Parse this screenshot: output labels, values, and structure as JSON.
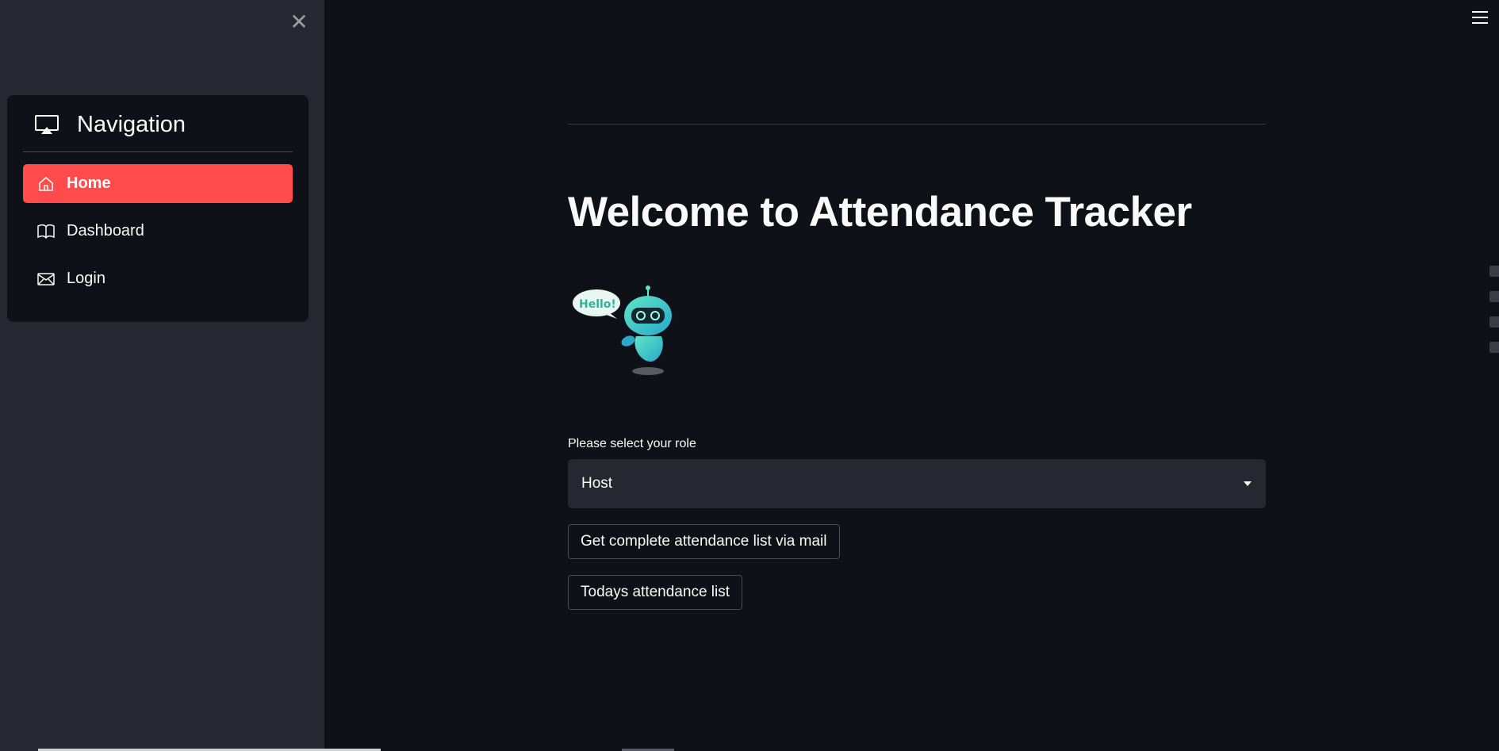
{
  "sidebar": {
    "title": "Navigation",
    "items": [
      {
        "label": "Home",
        "icon": "house-icon",
        "active": true
      },
      {
        "label": "Dashboard",
        "icon": "book-icon",
        "active": false
      },
      {
        "label": "Login",
        "icon": "envelope-icon",
        "active": false
      }
    ],
    "accent_color": "#ff4b4b"
  },
  "main": {
    "title": "Welcome to Attendance Tracker",
    "robot_bubble_text": "Hello!",
    "role_select": {
      "label": "Please select your role",
      "value": "Host"
    },
    "buttons": {
      "mail_list": "Get complete attendance list via mail",
      "todays_list": "Todays attendance list"
    }
  },
  "colors": {
    "background": "#0e1117",
    "sidebar_bg": "#262730",
    "text": "#fafafa"
  }
}
